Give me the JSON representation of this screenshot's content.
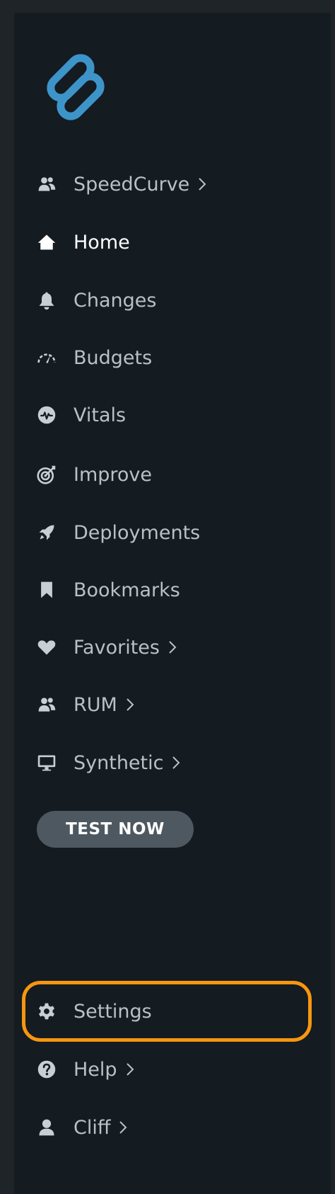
{
  "colors": {
    "page_bg": "#1f2429",
    "sidebar_bg": "#141b21",
    "text": "#b9c0c6",
    "text_active": "#ffffff",
    "logo": "#3d94c9",
    "button_bg": "#4e5860",
    "highlight": "#f7960f"
  },
  "nav": {
    "items": [
      {
        "label": "SpeedCurve",
        "icon": "users-icon",
        "has_submenu": true
      },
      {
        "label": "Home",
        "icon": "home-icon",
        "active": true
      },
      {
        "label": "Changes",
        "icon": "bell-icon"
      },
      {
        "label": "Budgets",
        "icon": "gauge-icon"
      },
      {
        "label": "Vitals",
        "icon": "heartbeat-icon"
      },
      {
        "label": "Improve",
        "icon": "target-icon"
      },
      {
        "label": "Deployments",
        "icon": "rocket-icon"
      },
      {
        "label": "Bookmarks",
        "icon": "bookmark-icon"
      },
      {
        "label": "Favorites",
        "icon": "heart-icon",
        "has_submenu": true
      },
      {
        "label": "RUM",
        "icon": "users-icon",
        "has_submenu": true
      },
      {
        "label": "Synthetic",
        "icon": "monitor-icon",
        "has_submenu": true
      }
    ],
    "bottom_items": [
      {
        "label": "Settings",
        "icon": "gear-icon",
        "highlighted": true
      },
      {
        "label": "Help",
        "icon": "question-circle-icon",
        "has_submenu": true
      },
      {
        "label": "Cliff",
        "icon": "user-icon",
        "has_submenu": true
      }
    ]
  },
  "test_button": {
    "label": "TEST NOW"
  }
}
